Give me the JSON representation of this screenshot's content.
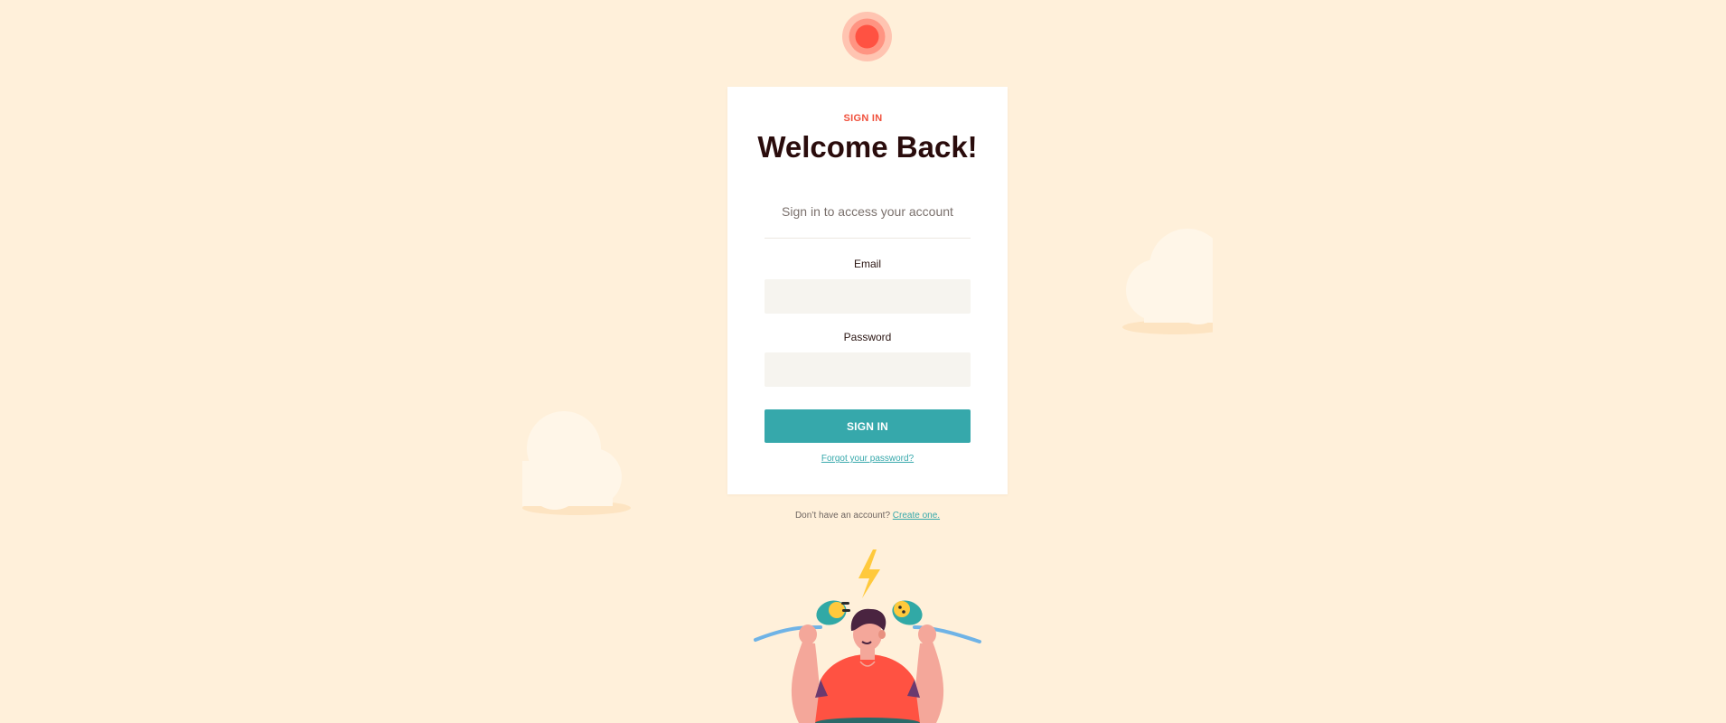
{
  "brand": {
    "logo_icon": "target-dot-icon",
    "accent_color": "#f0503c",
    "primary_color": "#36a8ab",
    "background_color": "#fff0da"
  },
  "card": {
    "eyebrow": "SIGN IN",
    "title": "Welcome Back!",
    "subtitle": "Sign in to access your account",
    "email": {
      "label": "Email",
      "value": "",
      "placeholder": ""
    },
    "password": {
      "label": "Password",
      "value": "",
      "placeholder": ""
    },
    "submit_label": "SIGN IN",
    "forgot_label": "Forgot your password?"
  },
  "footer": {
    "prompt": "Don’t have an account?",
    "create_label": "Create one."
  },
  "decor": {
    "clouds": [
      "cloud-icon",
      "cloud-icon"
    ],
    "illustration": "unplugged-person-illustration"
  }
}
